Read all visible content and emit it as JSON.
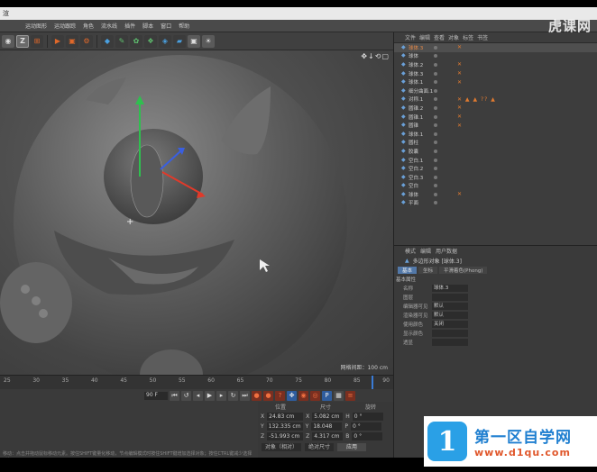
{
  "window": {
    "title": "渲"
  },
  "watermark": {
    "top_right": "虎课网",
    "bottom_title": "第一区自学网",
    "bottom_url": "www.d1qu.com",
    "logo_glyph": "1"
  },
  "menu": [
    "",
    "",
    "",
    "运动图形",
    "运动跟踪",
    "角色",
    "流水线",
    "插件",
    "脚本",
    "窗口",
    "帮助"
  ],
  "toolbar": {
    "z_label": "Z"
  },
  "viewport": {
    "nav_icons": "✥↓⟲▢",
    "status": "网格间距：100 cm"
  },
  "timeline": {
    "ticks": [
      "25",
      "30",
      "35",
      "40",
      "45",
      "50",
      "55",
      "60",
      "65",
      "70",
      "75",
      "80",
      "85",
      "90"
    ],
    "frame_value": "90 F",
    "current_frame": "0 F"
  },
  "coords": {
    "headers": [
      "位置",
      "尺寸",
      "旋转"
    ],
    "rows": [
      {
        "axis": "X",
        "pos": "24.83 cm",
        "saxis": "X",
        "size": "5.082 cm",
        "raxis": "H",
        "rot": "0 °"
      },
      {
        "axis": "Y",
        "pos": "132.335 cm",
        "saxis": "Y",
        "size": "18.048 cm",
        "raxis": "P",
        "rot": "0 °"
      },
      {
        "axis": "Z",
        "pos": "-51.993 cm",
        "saxis": "Z",
        "size": "4.317 cm",
        "raxis": "B",
        "rot": "0 °"
      }
    ],
    "mode": "对象（相对）",
    "size_mode": "绝对尺寸",
    "apply": "应用"
  },
  "statusbar": "移动：点击并拖动鼠标移动元素。按住SHIFT键量化移动，节点编辑模式时按住SHIFT键增加选择对象；按住CTRL键减少选择对象。",
  "object_manager": {
    "tabs": [
      "文件",
      "编辑",
      "查看",
      "对象",
      "标签",
      "书签"
    ],
    "rows": [
      {
        "name": "球体.3",
        "sel": true,
        "tags": "✕"
      },
      {
        "name": "球体",
        "sel": false,
        "tags": ""
      },
      {
        "name": "球体.2",
        "sel": false,
        "tags": "✕"
      },
      {
        "name": "球体.3",
        "sel": false,
        "tags": "✕"
      },
      {
        "name": "球体.1",
        "sel": false,
        "tags": "✕"
      },
      {
        "name": "细分曲面.1",
        "sel": false,
        "tags": ""
      },
      {
        "name": "对称.1",
        "sel": false,
        "tags": "✕ ▲ ▲ ?? ▲"
      },
      {
        "name": "圆锥.2",
        "sel": false,
        "tags": "✕"
      },
      {
        "name": "圆锥.1",
        "sel": false,
        "tags": "✕"
      },
      {
        "name": "圆锥",
        "sel": false,
        "tags": "✕"
      },
      {
        "name": "球体.1",
        "sel": false,
        "tags": ""
      },
      {
        "name": "圆柱",
        "sel": false,
        "tags": ""
      },
      {
        "name": "胶囊",
        "sel": false,
        "tags": ""
      },
      {
        "name": "空白.1",
        "sel": false,
        "tags": ""
      },
      {
        "name": "空白.2",
        "sel": false,
        "tags": ""
      },
      {
        "name": "空白.3",
        "sel": false,
        "tags": ""
      },
      {
        "name": "空白",
        "sel": false,
        "tags": ""
      },
      {
        "name": "球体",
        "sel": false,
        "tags": "✕"
      },
      {
        "name": "平面",
        "sel": false,
        "tags": ""
      }
    ]
  },
  "attributes": {
    "tabs": [
      "模式",
      "编辑",
      "用户数据"
    ],
    "object_label": "多边形对象 [球体.3]",
    "subtabs": [
      "基本",
      "坐标",
      "平滑着色(Phong)"
    ],
    "section": "基本属性",
    "rows": [
      {
        "label": "名称",
        "value": "球体.3"
      },
      {
        "label": "图层",
        "value": ""
      },
      {
        "label": "编辑器可见",
        "value": "默认"
      },
      {
        "label": "渲染器可见",
        "value": "默认"
      },
      {
        "label": "使用颜色",
        "value": "关闭"
      },
      {
        "label": "显示颜色",
        "value": ""
      },
      {
        "label": "透显",
        "value": ""
      }
    ]
  },
  "colors": {
    "accent_blue": "#5278a8",
    "accent_orange": "#e07a30",
    "axis_y": "#2fbf4f",
    "axis_x": "#e03a2a",
    "axis_z": "#3a5fe0"
  }
}
